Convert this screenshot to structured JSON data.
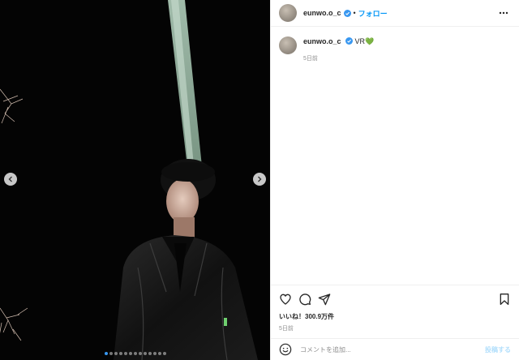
{
  "post": {
    "username": "eunwo.o_c",
    "follow_label": "フォロー",
    "separator": "•",
    "caption_text": "VR",
    "caption_emoji": "💚",
    "caption_time": "5日前",
    "likes_label": "いいね！300.9万件",
    "post_time": "5日前"
  },
  "comment": {
    "placeholder": "コメントを追加...",
    "post_label": "投稿する"
  },
  "carousel": {
    "slide_count": 13,
    "active_index": 0
  },
  "icons": {
    "verified": "verified-badge-icon",
    "more": "more-options-icon",
    "like": "heart-icon",
    "comment": "comment-icon",
    "share": "share-icon",
    "save": "bookmark-icon",
    "emoji": "emoji-icon",
    "prev": "chevron-left-icon",
    "next": "chevron-right-icon"
  },
  "colors": {
    "accent": "#0095f6",
    "verified": "#3897f0",
    "muted": "#8e8e8e",
    "post_disabled": "#b2dffc"
  }
}
